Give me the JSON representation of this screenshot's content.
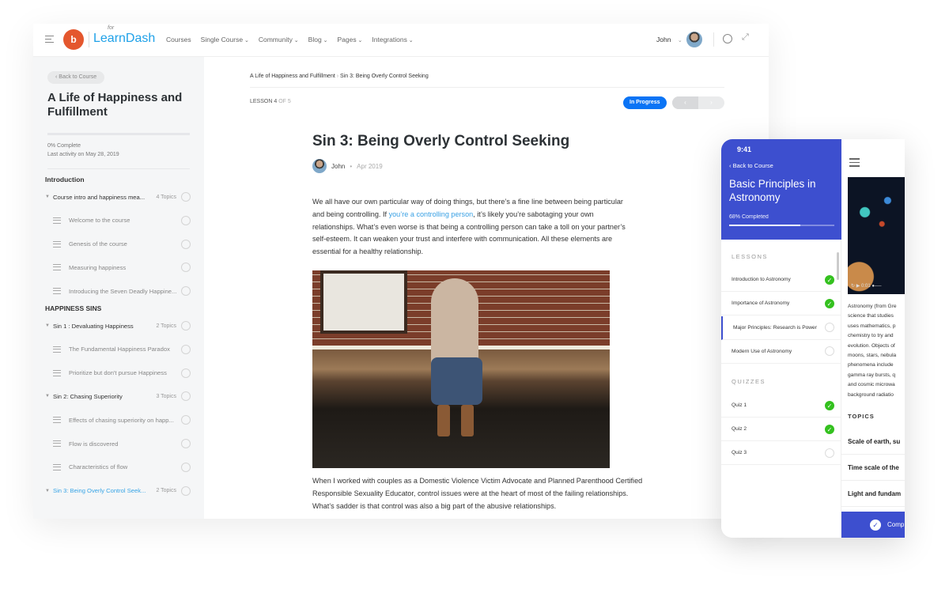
{
  "header": {
    "brand_for": "for",
    "brand": "LearnDash",
    "logo_mark": "b",
    "nav": [
      {
        "label": "Courses",
        "dropdown": false
      },
      {
        "label": "Single Course",
        "dropdown": true
      },
      {
        "label": "Community",
        "dropdown": true
      },
      {
        "label": "Blog",
        "dropdown": true
      },
      {
        "label": "Pages",
        "dropdown": true
      },
      {
        "label": "Integrations",
        "dropdown": true
      }
    ],
    "user": "John",
    "user_chevron": "⌄",
    "icons": [
      "menu-icon",
      "dark-mode-icon",
      "fullscreen-icon"
    ]
  },
  "sidebar": {
    "back": "‹  Back to Course",
    "course_title": "A Life of Happiness and Fulfillment",
    "progress_percent": 0,
    "complete": "0% Complete",
    "last_activity": "Last activity on May 28, 2019",
    "sections": [
      {
        "title": "Introduction",
        "items": [
          {
            "type": "lesson",
            "label": "Course intro and happiness mea...",
            "topics": "4 Topics"
          },
          {
            "type": "topic",
            "label": "Welcome to the course"
          },
          {
            "type": "topic",
            "label": "Genesis of the course"
          },
          {
            "type": "topic",
            "label": "Measuring happiness"
          },
          {
            "type": "topic",
            "label": "Introducing the Seven Deadly Happine..."
          }
        ]
      },
      {
        "title": "HAPPINESS SINS",
        "items": [
          {
            "type": "lesson",
            "label": "Sin 1 : Devaluating Happiness",
            "topics": "2 Topics"
          },
          {
            "type": "topic",
            "label": "The Fundamental Happiness Paradox"
          },
          {
            "type": "topic",
            "label": "Prioritize but don't pursue Happiness"
          },
          {
            "type": "lesson",
            "label": "Sin 2: Chasing Superiority",
            "topics": "3 Topics"
          },
          {
            "type": "topic",
            "label": "Effects of chasing superiority on happ..."
          },
          {
            "type": "topic",
            "label": "Flow is discovered"
          },
          {
            "type": "topic",
            "label": "Characteristics of flow"
          },
          {
            "type": "lesson",
            "label": "Sin 3: Being Overly Control Seek...",
            "topics": "2 Topics",
            "active": true
          }
        ]
      }
    ]
  },
  "main": {
    "breadcrumb": [
      "A Life of Happiness and Fulfillment",
      "Sin 3: Being Overly Control Seeking"
    ],
    "breadcrumb_sep": "›",
    "lesson_label": "LESSON 4",
    "lesson_of": " OF 5",
    "status": "In Progress",
    "prev": "‹",
    "next": "›",
    "title": "Sin 3: Being Overly Control Seeking",
    "author": "John",
    "dot": "•",
    "date": "Apr 2019",
    "p1_a": "We all have our own particular way of doing things, but there’s a fine line between being particular and being controlling. If ",
    "p1_link": "you’re a controlling person",
    "p1_b": ", it’s likely you’re sabotaging your own relationships. What’s even worse is that being a controlling person can take a toll on your partner’s self-esteem. It can weaken your trust and interfere with communication. All these elements are essential for a healthy relationship.",
    "p2": "When I worked with couples as a Domestic Violence Victim Advocate and Planned Parenthood Certified Responsible Sexuality Educator, control issues were at the heart of most of the failing relationships. What’s sadder is that control was also a big part of the abusive relationships."
  },
  "phone": {
    "time": "9:41",
    "back": "‹   Back to Course",
    "title": "Basic Principles in Astronomy",
    "completed": "68% Completed",
    "progress_percent": 68,
    "lessons_caption": "LESSONS",
    "lessons": [
      {
        "label": "Introduction to Astronomy",
        "done": true
      },
      {
        "label": "Importance of Astronomy",
        "done": true
      },
      {
        "label": "Major Principles: Research is Power",
        "done": false,
        "current": true
      },
      {
        "label": "Modern Use of Astronomy",
        "done": false
      }
    ],
    "quizzes_caption": "QUIZZES",
    "quizzes": [
      {
        "label": "Quiz 1",
        "done": true
      },
      {
        "label": "Quiz 2",
        "done": true
      },
      {
        "label": "Quiz 3",
        "done": false
      }
    ],
    "video_time": "0:01",
    "text_lines": [
      "Astronomy (from Gre",
      "science that studies",
      "uses mathematics, p",
      "chemistry to try and",
      "evolution. Objects of",
      "moons, stars, nebula",
      "phenomena include",
      "gamma ray bursts, q",
      "and cosmic microwa",
      "background radiatio"
    ],
    "topics_caption": "TOPICS",
    "topics": [
      "Scale of earth, su",
      "Time scale of the",
      "Light and fundam"
    ],
    "complete_btn": "Comp",
    "accent": "#3d4fcf",
    "done_color": "#34c11f"
  }
}
